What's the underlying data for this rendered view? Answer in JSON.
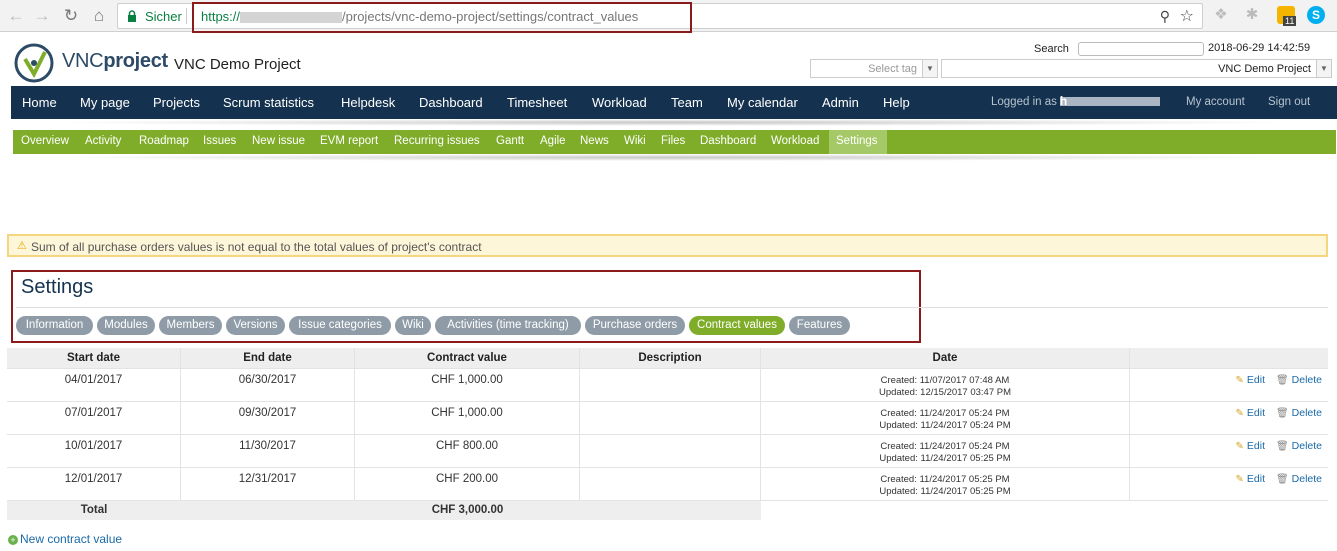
{
  "browser": {
    "secure_label": "Sicher",
    "url_scheme": "https://",
    "url_path": "/projects/vnc-demo-project/settings/contract_values"
  },
  "header": {
    "logo_light": "VNC",
    "logo_bold": "project",
    "project_title": "VNC Demo Project",
    "search_label": "Search",
    "datetime": "2018-06-29 14:42:59",
    "tag_placeholder": "Select tag",
    "project_select": "VNC Demo Project"
  },
  "top_menu": {
    "items": [
      "Home",
      "My page",
      "Projects",
      "Scrum statistics",
      "Helpdesk",
      "Dashboard",
      "Timesheet",
      "Workload",
      "Team",
      "My calendar",
      "Admin",
      "Help"
    ],
    "logged_in_label": "Logged in as",
    "my_account": "My account",
    "sign_out": "Sign out"
  },
  "project_menu": {
    "items": [
      "Overview",
      "Activity",
      "Roadmap",
      "Issues",
      "New issue",
      "EVM report",
      "Recurring issues",
      "Gantt",
      "Agile",
      "News",
      "Wiki",
      "Files",
      "Dashboard",
      "Workload",
      "Settings"
    ],
    "active": "Settings"
  },
  "flash": {
    "warning": "Sum of all purchase orders values is not equal to the total values of project's contract"
  },
  "settings": {
    "title": "Settings",
    "tabs": [
      "Information",
      "Modules",
      "Members",
      "Versions",
      "Issue categories",
      "Wiki",
      "Activities (time tracking)",
      "Purchase orders",
      "Contract values",
      "Features"
    ],
    "active_tab": "Contract values"
  },
  "table": {
    "headers": [
      "Start date",
      "End date",
      "Contract value",
      "Description",
      "Date",
      ""
    ],
    "rows": [
      {
        "start": "04/01/2017",
        "end": "06/30/2017",
        "value": "CHF 1,000.00",
        "description": "",
        "created": "Created: 11/07/2017 07:48 AM",
        "updated": "Updated: 12/15/2017 03:47 PM"
      },
      {
        "start": "07/01/2017",
        "end": "09/30/2017",
        "value": "CHF 1,000.00",
        "description": "",
        "created": "Created: 11/24/2017 05:24 PM",
        "updated": "Updated: 11/24/2017 05:24 PM"
      },
      {
        "start": "10/01/2017",
        "end": "11/30/2017",
        "value": "CHF 800.00",
        "description": "",
        "created": "Created: 11/24/2017 05:24 PM",
        "updated": "Updated: 11/24/2017 05:25 PM"
      },
      {
        "start": "12/01/2017",
        "end": "12/31/2017",
        "value": "CHF 200.00",
        "description": "",
        "created": "Created: 11/24/2017 05:25 PM",
        "updated": "Updated: 11/24/2017 05:25 PM"
      }
    ],
    "edit_label": "Edit",
    "delete_label": "Delete",
    "total_label": "Total",
    "total_value": "CHF 3,000.00"
  },
  "new_contract_link": "New contract value",
  "colors": {
    "top_menu_bg": "#14324f",
    "project_menu_bg": "#7fad2a",
    "active_tab": "#7fad2a",
    "highlight_border": "#8b1a1a"
  }
}
